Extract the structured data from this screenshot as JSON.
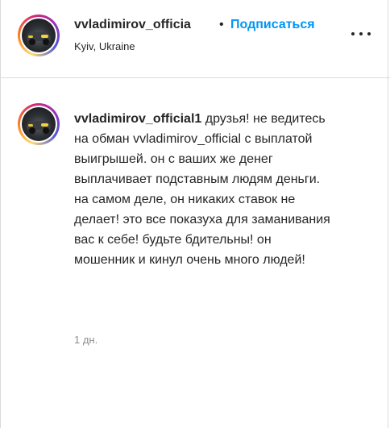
{
  "header": {
    "username": "vvladimirov_officia",
    "separator": "•",
    "follow_label": "Подписаться",
    "location": "Kyiv, Ukraine",
    "more_icon": "more-horizontal-icon"
  },
  "comment": {
    "author": "vvladimirov_official1",
    "text": " друзья! не ведитесь на обман vvladimirov_official с выплатой выигрышей. он с ваших же денег выплачивает подставным людям деньги. на самом деле, он никаких ставок не делает! это все показуха для заманивания вас к себе! будьте бдительны! он мошенник и кинул очень много людей!",
    "time": "1 дн."
  },
  "colors": {
    "link_blue": "#0095f6",
    "text": "#262626",
    "muted": "#8e8e8e",
    "divider": "#dbdbdb"
  }
}
